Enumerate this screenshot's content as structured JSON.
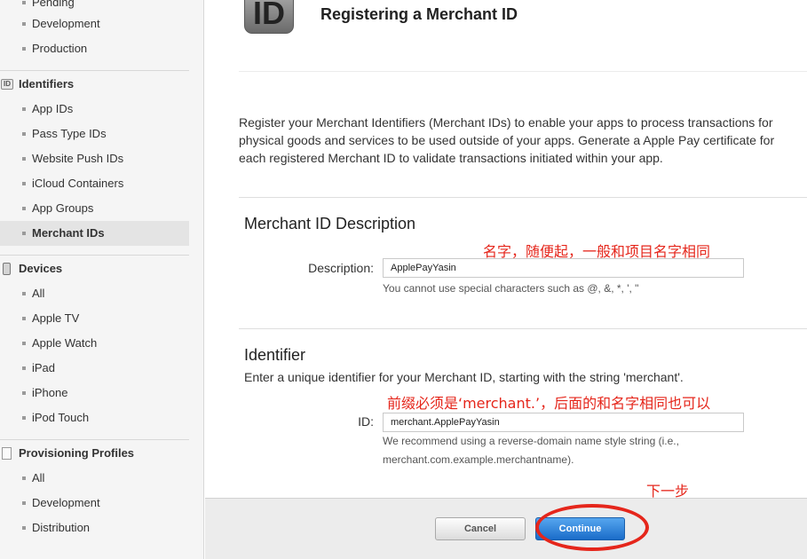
{
  "sidebar": {
    "certificates_items": [
      {
        "label": "Pending"
      },
      {
        "label": "Development"
      },
      {
        "label": "Production"
      }
    ],
    "identifiers": {
      "icon": "id-badge-icon",
      "icon_text": "ID",
      "heading": "Identifiers",
      "items": [
        {
          "label": "App IDs"
        },
        {
          "label": "Pass Type IDs"
        },
        {
          "label": "Website Push IDs"
        },
        {
          "label": "iCloud Containers"
        },
        {
          "label": "App Groups"
        },
        {
          "label": "Merchant IDs",
          "active": true
        }
      ]
    },
    "devices": {
      "icon": "device-icon",
      "heading": "Devices",
      "items": [
        {
          "label": "All"
        },
        {
          "label": "Apple TV"
        },
        {
          "label": "Apple Watch"
        },
        {
          "label": "iPad"
        },
        {
          "label": "iPhone"
        },
        {
          "label": "iPod Touch"
        }
      ]
    },
    "profiles": {
      "icon": "document-icon",
      "heading": "Provisioning Profiles",
      "items": [
        {
          "label": "All"
        },
        {
          "label": "Development"
        },
        {
          "label": "Distribution"
        }
      ]
    }
  },
  "header": {
    "logo_icon": "id-logo-icon",
    "logo_text": "ID",
    "title": "Registering a Merchant ID"
  },
  "intro": "Register your Merchant Identifiers (Merchant IDs) to enable your apps to process transactions for physical goods and services to be used outside of your apps. Generate a Apple Pay certificate for each registered Merchant ID to validate transactions initiated within your app.",
  "description_section": {
    "title": "Merchant ID Description",
    "label": "Description:",
    "value": "ApplePayYasin",
    "hint": "You cannot use special characters such as @, &, *, ', \""
  },
  "identifier_section": {
    "title": "Identifier",
    "description": "Enter a unique identifier for your Merchant ID, starting with the string 'merchant'.",
    "label": "ID:",
    "value": "merchant.ApplePayYasin",
    "hint_line1": "We recommend using a reverse-domain name style string (i.e.,",
    "hint_line2": "merchant.com.example.merchantname)."
  },
  "annotations": {
    "name_note": "名字，随便起，一般和项目名字相同",
    "id_note": "前缀必须是‘merchant.’，后面的和名字相同也可以",
    "next_note": "下一步"
  },
  "footer": {
    "cancel_label": "Cancel",
    "continue_label": "Continue"
  },
  "colors": {
    "annotation": "#e5261b",
    "primary_button": "#2a7fdc",
    "sidebar_bg": "#f5f5f5",
    "footer_bg": "#ececec"
  }
}
